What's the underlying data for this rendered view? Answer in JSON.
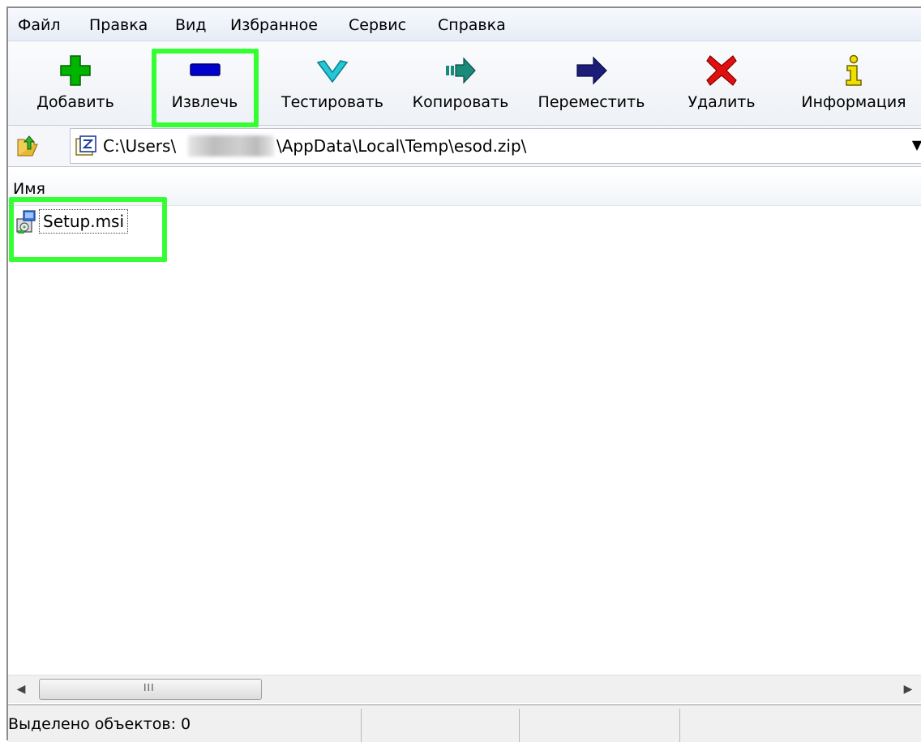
{
  "menu": [
    "Файл",
    "Правка",
    "Вид",
    "Избранное",
    "Сервис",
    "Справка"
  ],
  "toolbar": {
    "add": {
      "label": "Добавить",
      "icon": "plus-icon",
      "color": "#00b400"
    },
    "extract": {
      "label": "Извлечь",
      "icon": "minus-icon",
      "color": "#0000cc"
    },
    "test": {
      "label": "Тестировать",
      "icon": "checkmark-icon",
      "color": "#22c8d8"
    },
    "copy": {
      "label": "Копировать",
      "icon": "copy-arrow-icon",
      "color": "#1a8a7a"
    },
    "move": {
      "label": "Переместить",
      "icon": "move-arrow-icon",
      "color": "#1c1c7a"
    },
    "delete": {
      "label": "Удалить",
      "icon": "cross-icon",
      "color": "#e01010"
    },
    "info": {
      "label": "Информация",
      "icon": "info-icon",
      "color": "#f0e000"
    }
  },
  "address": {
    "path_prefix": "C:\\Users\\",
    "path_suffix": "\\AppData\\Local\\Temp\\esod.zip\\"
  },
  "list": {
    "column_name": "Имя",
    "files": [
      {
        "name": "Setup.msi",
        "icon": "msi-installer-icon"
      }
    ]
  },
  "scrollbar": {
    "grip": "III"
  },
  "status": {
    "selected": "Выделено объектов: 0"
  },
  "highlight_color": "#33ff33"
}
